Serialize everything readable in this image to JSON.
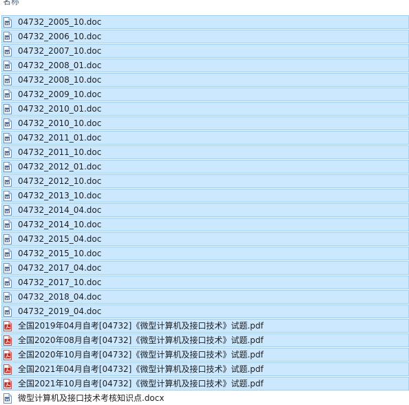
{
  "header": {
    "name_column": "名称"
  },
  "files": [
    {
      "name": "04732_2005_10.doc",
      "icon": "word-doc-icon",
      "selected": true
    },
    {
      "name": "04732_2006_10.doc",
      "icon": "word-doc-icon",
      "selected": true
    },
    {
      "name": "04732_2007_10.doc",
      "icon": "word-doc-icon",
      "selected": true
    },
    {
      "name": "04732_2008_01.doc",
      "icon": "word-doc-icon",
      "selected": true
    },
    {
      "name": "04732_2008_10.doc",
      "icon": "word-doc-icon",
      "selected": true
    },
    {
      "name": "04732_2009_10.doc",
      "icon": "word-doc-icon",
      "selected": true
    },
    {
      "name": "04732_2010_01.doc",
      "icon": "word-doc-icon",
      "selected": true
    },
    {
      "name": "04732_2010_10.doc",
      "icon": "word-doc-icon",
      "selected": true
    },
    {
      "name": "04732_2011_01.doc",
      "icon": "word-doc-icon",
      "selected": true
    },
    {
      "name": "04732_2011_10.doc",
      "icon": "word-doc-icon",
      "selected": true
    },
    {
      "name": "04732_2012_01.doc",
      "icon": "word-doc-icon",
      "selected": true
    },
    {
      "name": "04732_2012_10.doc",
      "icon": "word-doc-icon",
      "selected": true
    },
    {
      "name": "04732_2013_10.doc",
      "icon": "word-doc-icon",
      "selected": true
    },
    {
      "name": "04732_2014_04.doc",
      "icon": "word-doc-icon",
      "selected": true
    },
    {
      "name": "04732_2014_10.doc",
      "icon": "word-doc-icon",
      "selected": true
    },
    {
      "name": "04732_2015_04.doc",
      "icon": "word-doc-icon",
      "selected": true
    },
    {
      "name": "04732_2015_10.doc",
      "icon": "word-doc-icon",
      "selected": true
    },
    {
      "name": "04732_2017_04.doc",
      "icon": "word-doc-icon",
      "selected": true
    },
    {
      "name": "04732_2017_10.doc",
      "icon": "word-doc-icon",
      "selected": true
    },
    {
      "name": "04732_2018_04.doc",
      "icon": "word-doc-icon",
      "selected": true
    },
    {
      "name": "04732_2019_04.doc",
      "icon": "word-doc-icon",
      "selected": true
    },
    {
      "name": "全国2019年04月自考[04732]《微型计算机及接口技术》试题.pdf",
      "icon": "pdf-icon",
      "selected": true
    },
    {
      "name": "全国2020年08月自考[04732]《微型计算机及接口技术》试题.pdf",
      "icon": "pdf-icon",
      "selected": true
    },
    {
      "name": "全国2020年10月自考[04732]《微型计算机及接口技术》试题.pdf",
      "icon": "pdf-icon",
      "selected": true
    },
    {
      "name": "全国2021年04月自考[04732]《微型计算机及接口技术》试题.pdf",
      "icon": "pdf-icon",
      "selected": true
    },
    {
      "name": "全国2021年10月自考[04732]《微型计算机及接口技术》试题.pdf",
      "icon": "pdf-icon",
      "selected": true
    },
    {
      "name": "微型计算机及接口技术考核知识点.docx",
      "icon": "word-doc-icon",
      "selected": false
    }
  ],
  "colors": {
    "selection_fill": "#cce8ff",
    "selection_border": "#99d1ff",
    "word_blue": "#2b579a",
    "pdf_red": "#d9261c"
  }
}
